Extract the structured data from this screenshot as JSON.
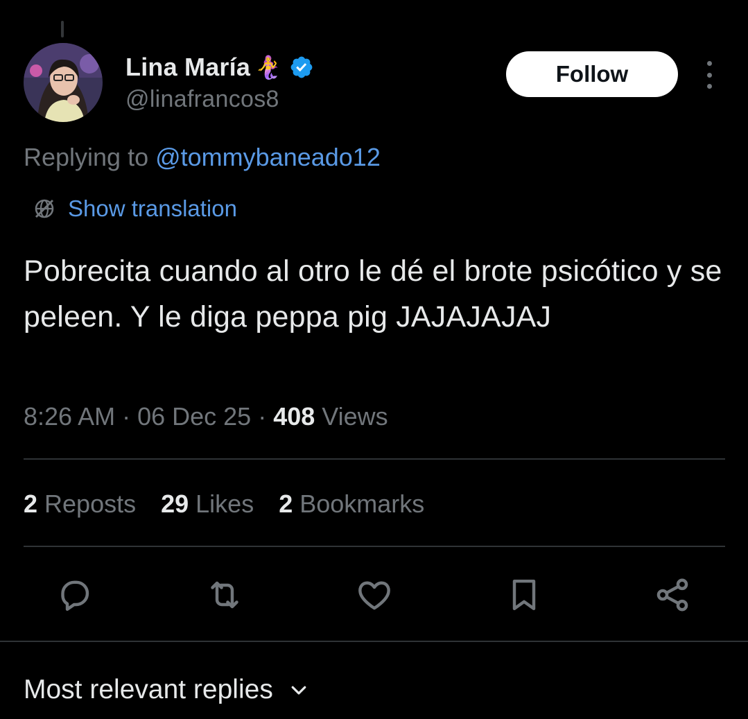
{
  "author": {
    "display_name": "Lina María",
    "name_emoji": "🧜‍♀️",
    "handle": "@linafrancos8",
    "verified": true,
    "avatar_icon": "profile-photo"
  },
  "follow_button": {
    "label": "Follow"
  },
  "more_menu": {
    "icon": "more-vertical-icon"
  },
  "reply_context": {
    "prefix": "Replying to ",
    "mention": "@tommybaneado12"
  },
  "translation": {
    "label": "Show translation",
    "icon": "translate-globe-icon"
  },
  "tweet": {
    "text": "Pobrecita cuando al otro le dé el brote psicótico y se peleen. Y le diga peppa pig JAJAJAJAJ",
    "time": "8:26 AM",
    "date": "06 Dec 25",
    "separator": " · ",
    "views_count": "408",
    "views_label": "Views"
  },
  "stats": {
    "reposts_count": "2",
    "reposts_label": "Reposts",
    "likes_count": "29",
    "likes_label": "Likes",
    "bookmarks_count": "2",
    "bookmarks_label": "Bookmarks"
  },
  "actions": [
    "reply-icon",
    "repost-icon",
    "like-icon",
    "bookmark-icon",
    "share-icon"
  ],
  "replies_sort": {
    "label": "Most relevant replies",
    "icon": "chevron-down-icon"
  },
  "colors": {
    "background": "#000000",
    "text_primary": "#e7e9ea",
    "text_secondary": "#71767b",
    "link": "#5a9ae6",
    "verified": "#1d9bf0",
    "divider": "#2f3336",
    "follow_bg": "#ffffff"
  }
}
